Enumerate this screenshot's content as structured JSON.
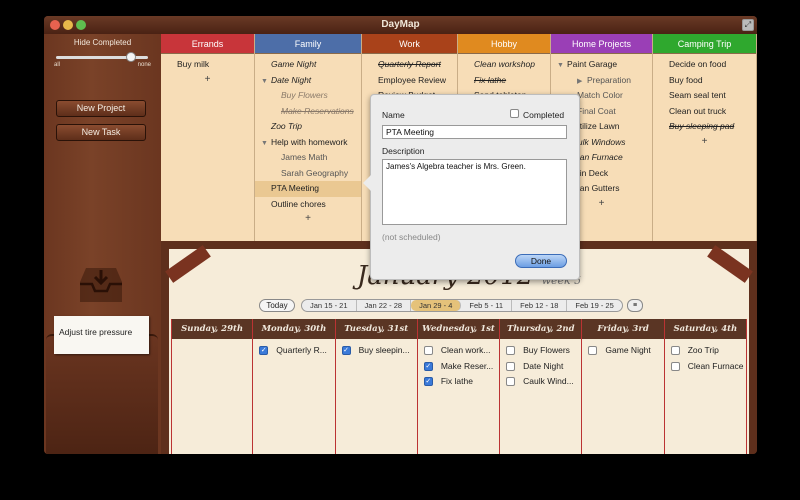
{
  "window": {
    "title": "DayMap"
  },
  "sidebar": {
    "hide_completed_label": "Hide Completed",
    "slider_min_label": "all",
    "slider_max_label": "none",
    "slider_value_fraction": 0.85,
    "new_project_label": "New Project",
    "new_task_label": "New Task",
    "note_text": "Adjust tire pressure"
  },
  "projects": [
    {
      "name": "Errands",
      "color": "#c8353a",
      "tasks": [
        {
          "text": "Buy milk"
        }
      ]
    },
    {
      "name": "Family",
      "color": "#4d6ea8",
      "tasks": [
        {
          "text": "Game Night",
          "style": "italic"
        },
        {
          "text": "Date Night",
          "style": "italic",
          "expanded": true
        },
        {
          "text": "Buy Flowers",
          "style": "italic",
          "sub": true
        },
        {
          "text": "Make Reservations",
          "style": "strike",
          "sub": true
        },
        {
          "text": "Zoo Trip",
          "style": "italic"
        },
        {
          "text": "Help with homework",
          "expanded": true
        },
        {
          "text": "James Math",
          "sub": true
        },
        {
          "text": "Sarah Geography",
          "sub": true
        },
        {
          "text": "PTA Meeting",
          "selected": true
        },
        {
          "text": "Outline chores"
        }
      ]
    },
    {
      "name": "Work",
      "color": "#a9421a",
      "tasks": [
        {
          "text": "Quarterly Report",
          "style": "strike"
        },
        {
          "text": "Employee Review"
        },
        {
          "text": "Review Budget"
        }
      ]
    },
    {
      "name": "Hobby",
      "color": "#e08a1f",
      "tasks": [
        {
          "text": "Clean workshop",
          "style": "italic"
        },
        {
          "text": "Fix lathe",
          "style": "strike"
        },
        {
          "text": "Sand tabletop"
        }
      ]
    },
    {
      "name": "Home Projects",
      "color": "#9a3fb6",
      "tasks": [
        {
          "text": "Paint Garage",
          "expanded": true
        },
        {
          "text": "Preparation",
          "sub": true,
          "collapsed": true
        },
        {
          "text": "Match Color",
          "sub": true
        },
        {
          "text": "Final Coat",
          "sub": true
        },
        {
          "text": "Fertilize Lawn"
        },
        {
          "text": "Caulk Windows",
          "style": "italic"
        },
        {
          "text": "Clean Furnace",
          "style": "italic"
        },
        {
          "text": "Stain Deck"
        },
        {
          "text": "Clean Gutters"
        }
      ]
    },
    {
      "name": "Camping Trip",
      "color": "#2fa82e",
      "tasks": [
        {
          "text": "Decide on food"
        },
        {
          "text": "Buy food"
        },
        {
          "text": "Seam seal tent"
        },
        {
          "text": "Clean out truck"
        },
        {
          "text": "Buy sleeping pad",
          "style": "strike"
        }
      ]
    }
  ],
  "add_symbol": "+",
  "popover": {
    "name_label": "Name",
    "completed_label": "Completed",
    "name_value": "PTA Meeting",
    "description_label": "Description",
    "description_value": "James's Algebra teacher is Mrs. Green.",
    "schedule_text": "(not scheduled)",
    "done_label": "Done"
  },
  "calendar": {
    "title": "January 2012",
    "week_label": "week 5",
    "today_label": "Today",
    "menu_symbol": "≡",
    "weeks": [
      {
        "label": "Jan 15 - 21"
      },
      {
        "label": "Jan 22 - 28"
      },
      {
        "label": "Jan 29 - 4",
        "active": true
      },
      {
        "label": "Feb 5 - 11"
      },
      {
        "label": "Feb 12 - 18"
      },
      {
        "label": "Feb 19 - 25"
      }
    ],
    "days": [
      {
        "label": "Sunday, 29th",
        "events": []
      },
      {
        "label": "Monday, 30th",
        "events": [
          {
            "text": "Quarterly R...",
            "checked": true
          }
        ]
      },
      {
        "label": "Tuesday, 31st",
        "events": [
          {
            "text": "Buy sleepin...",
            "checked": true
          }
        ]
      },
      {
        "label": "Wednesday, 1st",
        "events": [
          {
            "text": "Clean work...",
            "checked": false
          },
          {
            "text": "Make Reser...",
            "checked": true
          },
          {
            "text": "Fix lathe",
            "checked": true
          }
        ]
      },
      {
        "label": "Thursday, 2nd",
        "events": [
          {
            "text": "Buy Flowers",
            "checked": false
          },
          {
            "text": "Date Night",
            "checked": false
          },
          {
            "text": "Caulk Wind...",
            "checked": false
          }
        ]
      },
      {
        "label": "Friday, 3rd",
        "events": [
          {
            "text": "Game Night",
            "checked": false
          }
        ]
      },
      {
        "label": "Saturday, 4th",
        "events": [
          {
            "text": "Zoo Trip",
            "checked": false
          },
          {
            "text": "Clean Furnace",
            "checked": false
          }
        ]
      }
    ]
  }
}
